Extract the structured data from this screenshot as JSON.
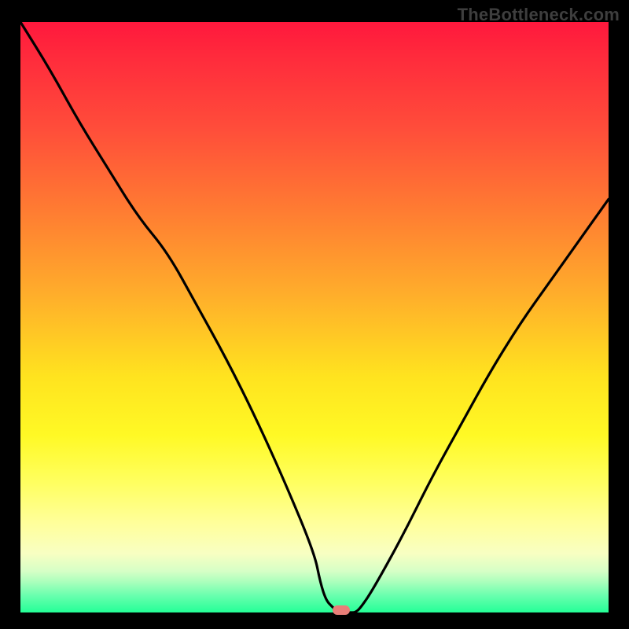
{
  "watermark": "TheBottleneck.com",
  "marker": {
    "position_frac_x": 0.545,
    "color": "#e97e78"
  },
  "chart_data": {
    "type": "line",
    "title": "",
    "xlabel": "",
    "ylabel": "",
    "xlim": [
      0,
      100
    ],
    "ylim": [
      0,
      100
    ],
    "grid": false,
    "legend": false,
    "series": [
      {
        "name": "bottleneck-curve",
        "x": [
          0,
          5,
          10,
          15,
          20,
          25,
          30,
          35,
          40,
          45,
          50,
          51,
          52,
          53,
          54,
          55,
          56,
          57,
          58,
          60,
          65,
          70,
          75,
          80,
          85,
          90,
          95,
          100
        ],
        "y": [
          100,
          92,
          83,
          75,
          67,
          61,
          52,
          43,
          33,
          22,
          10,
          5,
          2,
          1,
          0,
          0,
          0,
          0,
          1,
          4,
          13,
          23,
          32,
          41,
          49,
          56,
          63,
          70
        ]
      }
    ],
    "annotations": [
      {
        "type": "marker",
        "shape": "pill",
        "x": 54.5,
        "y": 0.4,
        "color": "#e97e78"
      }
    ],
    "background": {
      "type": "vertical-gradient",
      "stops": [
        {
          "pos": 0.0,
          "color": "#ff183d"
        },
        {
          "pos": 0.32,
          "color": "#ff7c32"
        },
        {
          "pos": 0.6,
          "color": "#ffe31f"
        },
        {
          "pos": 0.85,
          "color": "#ffff9c"
        },
        {
          "pos": 1.0,
          "color": "#24ff97"
        }
      ]
    }
  }
}
